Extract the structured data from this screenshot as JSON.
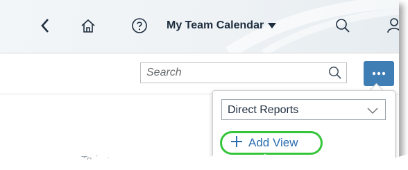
{
  "shellbar": {
    "back_icon": "chevron-left-icon",
    "home_icon": "home-icon",
    "help_icon": "help-icon",
    "title": "My Team Calendar",
    "title_dropdown_icon": "caret-down-icon",
    "search_icon": "search-icon",
    "user_icon": "user-icon"
  },
  "toolbar": {
    "search_placeholder": "Search",
    "overflow_icon": "overflow-icon"
  },
  "popover": {
    "view_select_value": "Direct Reports",
    "add_view_label": "Add View"
  },
  "calendar_nav": {
    "today_label": "Today",
    "next_label": "›"
  },
  "colors": {
    "accent": "#3f7eb5",
    "link": "#2a6db0",
    "highlight": "#35c53a"
  }
}
